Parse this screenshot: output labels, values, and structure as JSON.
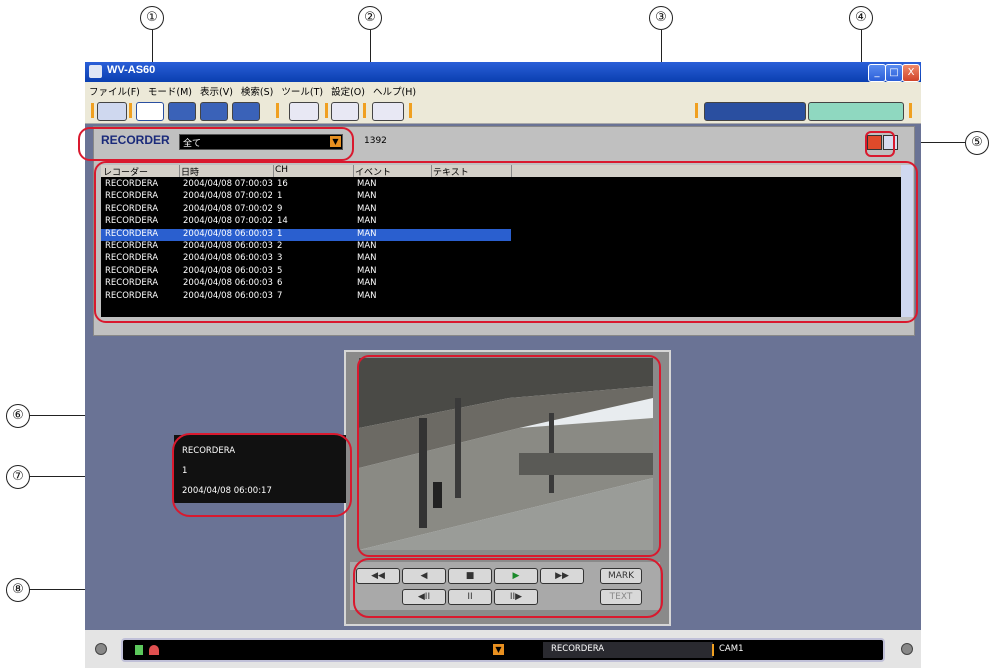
{
  "callouts": [
    "①",
    "②",
    "③",
    "④",
    "⑤",
    "⑥",
    "⑦",
    "⑧"
  ],
  "window": {
    "title": "WV-AS60",
    "min_label": "_",
    "max_label": "□",
    "close_label": "X",
    "icon": "camera-app-icon"
  },
  "menu": [
    "ファイル(F)",
    "モード(M)",
    "表示(V)",
    "検索(S)",
    "ツール(T)",
    "設定(O)",
    "ヘルプ(H)"
  ],
  "recorder": {
    "label": "RECORDER",
    "select_value": "全て",
    "count": "1392"
  },
  "table": {
    "columns": [
      "レコーダー",
      "日時",
      "CH",
      "イベント",
      "テキスト"
    ],
    "rows": [
      {
        "rec": "RECORDERA",
        "datetime": "2004/04/08 07:00:03",
        "ch": "16",
        "event": "MAN"
      },
      {
        "rec": "RECORDERA",
        "datetime": "2004/04/08 07:00:02",
        "ch": "1",
        "event": "MAN"
      },
      {
        "rec": "RECORDERA",
        "datetime": "2004/04/08 07:00:02",
        "ch": "9",
        "event": "MAN"
      },
      {
        "rec": "RECORDERA",
        "datetime": "2004/04/08 07:00:02",
        "ch": "14",
        "event": "MAN"
      },
      {
        "rec": "RECORDERA",
        "datetime": "2004/04/08 06:00:03",
        "ch": "1",
        "event": "MAN"
      },
      {
        "rec": "RECORDERA",
        "datetime": "2004/04/08 06:00:03",
        "ch": "2",
        "event": "MAN"
      },
      {
        "rec": "RECORDERA",
        "datetime": "2004/04/08 06:00:03",
        "ch": "3",
        "event": "MAN"
      },
      {
        "rec": "RECORDERA",
        "datetime": "2004/04/08 06:00:03",
        "ch": "5",
        "event": "MAN"
      },
      {
        "rec": "RECORDERA",
        "datetime": "2004/04/08 06:00:03",
        "ch": "6",
        "event": "MAN"
      },
      {
        "rec": "RECORDERA",
        "datetime": "2004/04/08 06:00:03",
        "ch": "7",
        "event": "MAN"
      }
    ],
    "selected_index": 4
  },
  "info": {
    "recorder": "RECORDERA",
    "channel": "1",
    "datetime": "2004/04/08 06:00:17"
  },
  "controls": {
    "mark": "MARK",
    "text": "TEXT"
  },
  "status": {
    "recorder": "RECORDERA",
    "camera": "CAM1"
  },
  "colors": {
    "window_bg": "#6a7395",
    "highlight": "#2a5fcf",
    "annotation_red": "#d9192e",
    "accent_orange": "#f0a020"
  }
}
